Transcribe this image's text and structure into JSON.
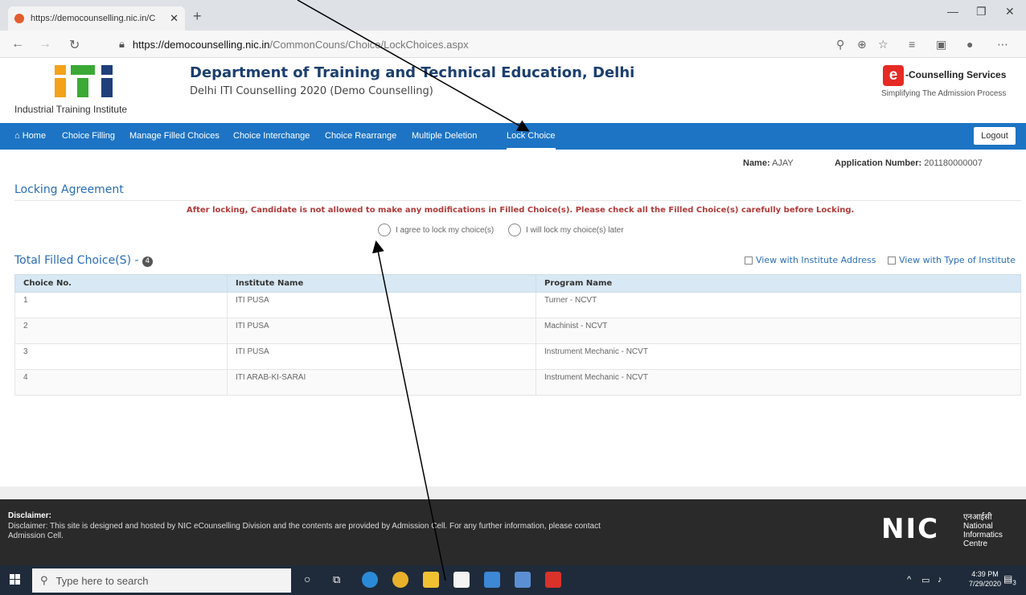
{
  "browser": {
    "tab_title": "https://democounselling.nic.in/C",
    "url_host": "https://democounselling.nic.in",
    "url_path": "/CommonCouns/Choice/LockChoices.aspx"
  },
  "header": {
    "logo_caption": "Industrial Training Institute",
    "title": "Department of Training and Technical Education, Delhi",
    "subtitle": "Delhi ITI Counselling 2020 (Demo Counselling)",
    "brand_title": "-Counselling Services",
    "brand_sub": "Simplifying The Admission Process"
  },
  "nav": {
    "home": "Home",
    "items": [
      "Choice Filling",
      "Manage Filled Choices",
      "Choice Interchange",
      "Choice Rearrange",
      "Multiple Deletion",
      "Lock Choice"
    ],
    "logout": "Logout"
  },
  "user": {
    "name_label": "Name:",
    "name": "AJAY",
    "app_label": "Application Number:",
    "app_number": "201180000007"
  },
  "locking": {
    "title": "Locking Agreement",
    "warning": "After locking, Candidate is not allowed to make any modifications in Filled Choice(s). Please check all the Filled Choice(s) carefully before Locking.",
    "agree": "I agree to lock my choice(s)",
    "later": "I will lock my choice(s) later"
  },
  "choices": {
    "title": "Total Filled Choice(S) -",
    "count": "4",
    "opt_address": "View with Institute Address",
    "opt_type": "View with Type of Institute",
    "columns": [
      "Choice No.",
      "Institute Name",
      "Program Name"
    ],
    "rows": [
      {
        "no": "1",
        "institute": "ITI PUSA",
        "program": "Turner - NCVT"
      },
      {
        "no": "2",
        "institute": "ITI PUSA",
        "program": "Machinist - NCVT"
      },
      {
        "no": "3",
        "institute": "ITI PUSA",
        "program": "Instrument Mechanic - NCVT"
      },
      {
        "no": "4",
        "institute": "ITI ARAB-KI-SARAI",
        "program": "Instrument Mechanic - NCVT"
      }
    ]
  },
  "footer": {
    "disclaimer_head": "Disclaimer:",
    "disclaimer_text": "Disclaimer: This site is designed and hosted by NIC eCounselling Division and the contents are provided by Admission Cell. For any further information, please contact Admission Cell.",
    "nic_logo": "NIC",
    "nic_hindi": "एनआईसी",
    "nic_line1": "National",
    "nic_line2": "Informatics",
    "nic_line3": "Centre"
  },
  "taskbar": {
    "search_placeholder": "Type here to search",
    "time": "4:39 PM",
    "date": "7/29/2020",
    "notification_count": "3"
  },
  "colors": {
    "nav_blue": "#1d74c4",
    "title_blue": "#1c3f6e",
    "warning_red": "#b03a3a",
    "table_header": "#d8e8f4"
  }
}
